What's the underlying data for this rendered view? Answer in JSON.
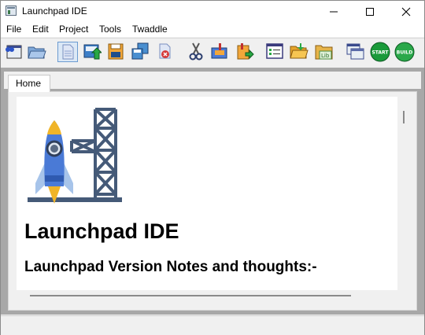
{
  "window": {
    "title": "Launchpad IDE",
    "minimize_glyph": "—",
    "maximize_glyph": "☐",
    "close_glyph": "✕"
  },
  "menu": [
    "File",
    "Edit",
    "Project",
    "Tools",
    "Twaddle"
  ],
  "toolbar": {
    "buttons": [
      {
        "icon": "view-icon"
      },
      {
        "icon": "open-folder-icon"
      },
      {
        "icon": "new-file-icon"
      },
      {
        "icon": "upload-icon"
      },
      {
        "icon": "save-icon"
      },
      {
        "icon": "save-all-icon"
      },
      {
        "icon": "close-file-icon"
      },
      {
        "icon": "cut-icon"
      },
      {
        "icon": "copy-icon"
      },
      {
        "icon": "paste-icon"
      },
      {
        "icon": "list-icon"
      },
      {
        "icon": "open-project-icon"
      },
      {
        "icon": "library-icon",
        "label": "Lib"
      },
      {
        "icon": "window-icon"
      },
      {
        "icon": "start-icon",
        "label": "START"
      },
      {
        "icon": "build-icon",
        "label": "BUILD"
      }
    ]
  },
  "tabs": [
    {
      "label": "Home",
      "active": true
    }
  ],
  "document": {
    "heading": "Launchpad IDE",
    "subheading": "Launchpad Version Notes and thoughts:-"
  },
  "colors": {
    "rocket_blue": "#4a7ad6",
    "tower_slate": "#455a78",
    "flame_yellow": "#f0b428",
    "start_green": "#1a9a3a",
    "build_green": "#2aa84a"
  }
}
